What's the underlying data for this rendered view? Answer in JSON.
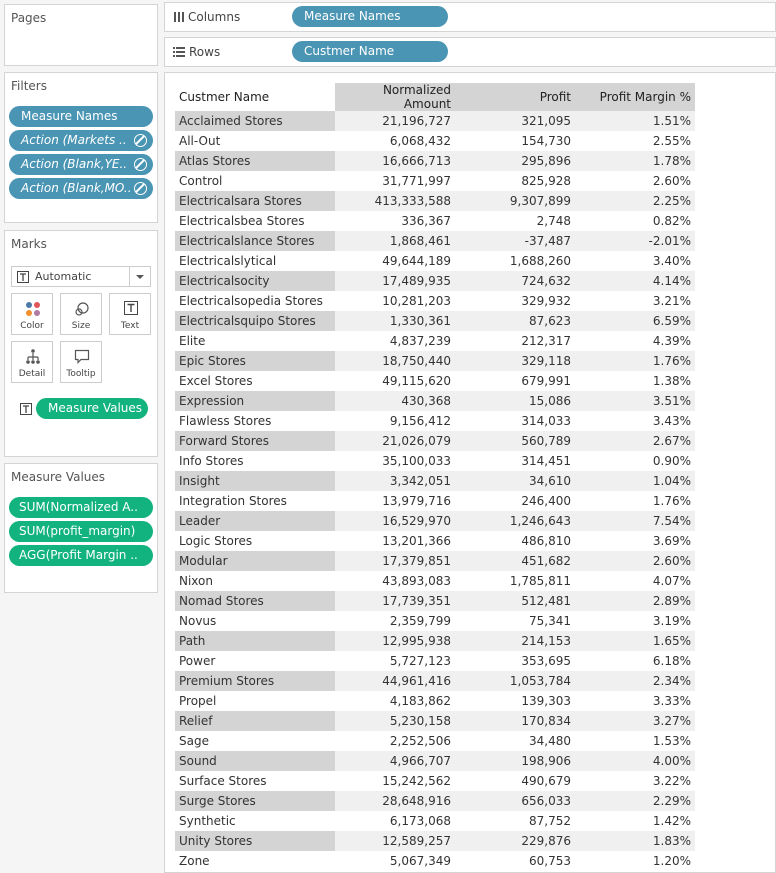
{
  "pages": {
    "title": "Pages"
  },
  "columns_shelf": {
    "label": "Columns",
    "pill": "Measure Names"
  },
  "rows_shelf": {
    "label": "Rows",
    "pill": "Custmer Name"
  },
  "filters": {
    "title": "Filters",
    "items": [
      "Measure Names",
      "Action (Markets ..",
      "Action (Blank,YE..",
      "Action (Blank,MO.."
    ]
  },
  "marks": {
    "title": "Marks",
    "type": "Automatic",
    "buttons": [
      "Color",
      "Size",
      "Text",
      "Detail",
      "Tooltip"
    ],
    "text_pill": "Measure Values"
  },
  "measure_values": {
    "title": "Measure Values",
    "items": [
      "SUM(Normalized A..",
      "SUM(profit_margin)",
      "AGG(Profit Margin .."
    ]
  },
  "table": {
    "headers": [
      "Custmer Name",
      "Normalized Amount",
      "Profit",
      "Profit Margin %"
    ],
    "rows": [
      [
        "Acclaimed Stores",
        "21,196,727",
        "321,095",
        "1.51%"
      ],
      [
        "All-Out",
        "6,068,432",
        "154,730",
        "2.55%"
      ],
      [
        "Atlas Stores",
        "16,666,713",
        "295,896",
        "1.78%"
      ],
      [
        "Control",
        "31,771,997",
        "825,928",
        "2.60%"
      ],
      [
        "Electricalsara Stores",
        "413,333,588",
        "9,307,899",
        "2.25%"
      ],
      [
        "Electricalsbea Stores",
        "336,367",
        "2,748",
        "0.82%"
      ],
      [
        "Electricalslance Stores",
        "1,868,461",
        "-37,487",
        "-2.01%"
      ],
      [
        "Electricalslytical",
        "49,644,189",
        "1,688,260",
        "3.40%"
      ],
      [
        "Electricalsocity",
        "17,489,935",
        "724,632",
        "4.14%"
      ],
      [
        "Electricalsopedia Stores",
        "10,281,203",
        "329,932",
        "3.21%"
      ],
      [
        "Electricalsquipo Stores",
        "1,330,361",
        "87,623",
        "6.59%"
      ],
      [
        "Elite",
        "4,837,239",
        "212,317",
        "4.39%"
      ],
      [
        "Epic Stores",
        "18,750,440",
        "329,118",
        "1.76%"
      ],
      [
        "Excel Stores",
        "49,115,620",
        "679,991",
        "1.38%"
      ],
      [
        "Expression",
        "430,368",
        "15,086",
        "3.51%"
      ],
      [
        "Flawless Stores",
        "9,156,412",
        "314,033",
        "3.43%"
      ],
      [
        "Forward Stores",
        "21,026,079",
        "560,789",
        "2.67%"
      ],
      [
        "Info Stores",
        "35,100,033",
        "314,451",
        "0.90%"
      ],
      [
        "Insight",
        "3,342,051",
        "34,610",
        "1.04%"
      ],
      [
        "Integration Stores",
        "13,979,716",
        "246,400",
        "1.76%"
      ],
      [
        "Leader",
        "16,529,970",
        "1,246,643",
        "7.54%"
      ],
      [
        "Logic Stores",
        "13,201,366",
        "486,810",
        "3.69%"
      ],
      [
        "Modular",
        "17,379,851",
        "451,682",
        "2.60%"
      ],
      [
        "Nixon",
        "43,893,083",
        "1,785,811",
        "4.07%"
      ],
      [
        "Nomad Stores",
        "17,739,351",
        "512,481",
        "2.89%"
      ],
      [
        "Novus",
        "2,359,799",
        "75,341",
        "3.19%"
      ],
      [
        "Path",
        "12,995,938",
        "214,153",
        "1.65%"
      ],
      [
        "Power",
        "5,727,123",
        "353,695",
        "6.18%"
      ],
      [
        "Premium Stores",
        "44,961,416",
        "1,053,784",
        "2.34%"
      ],
      [
        "Propel",
        "4,183,862",
        "139,303",
        "3.33%"
      ],
      [
        "Relief",
        "5,230,158",
        "170,834",
        "3.27%"
      ],
      [
        "Sage",
        "2,252,506",
        "34,480",
        "1.53%"
      ],
      [
        "Sound",
        "4,966,707",
        "198,906",
        "4.00%"
      ],
      [
        "Surface Stores",
        "15,242,562",
        "490,679",
        "3.22%"
      ],
      [
        "Surge Stores",
        "28,648,916",
        "656,033",
        "2.29%"
      ],
      [
        "Synthetic",
        "6,173,068",
        "87,752",
        "1.42%"
      ],
      [
        "Unity Stores",
        "12,589,257",
        "229,876",
        "1.83%"
      ],
      [
        "Zone",
        "5,067,349",
        "60,753",
        "1.20%"
      ]
    ]
  }
}
